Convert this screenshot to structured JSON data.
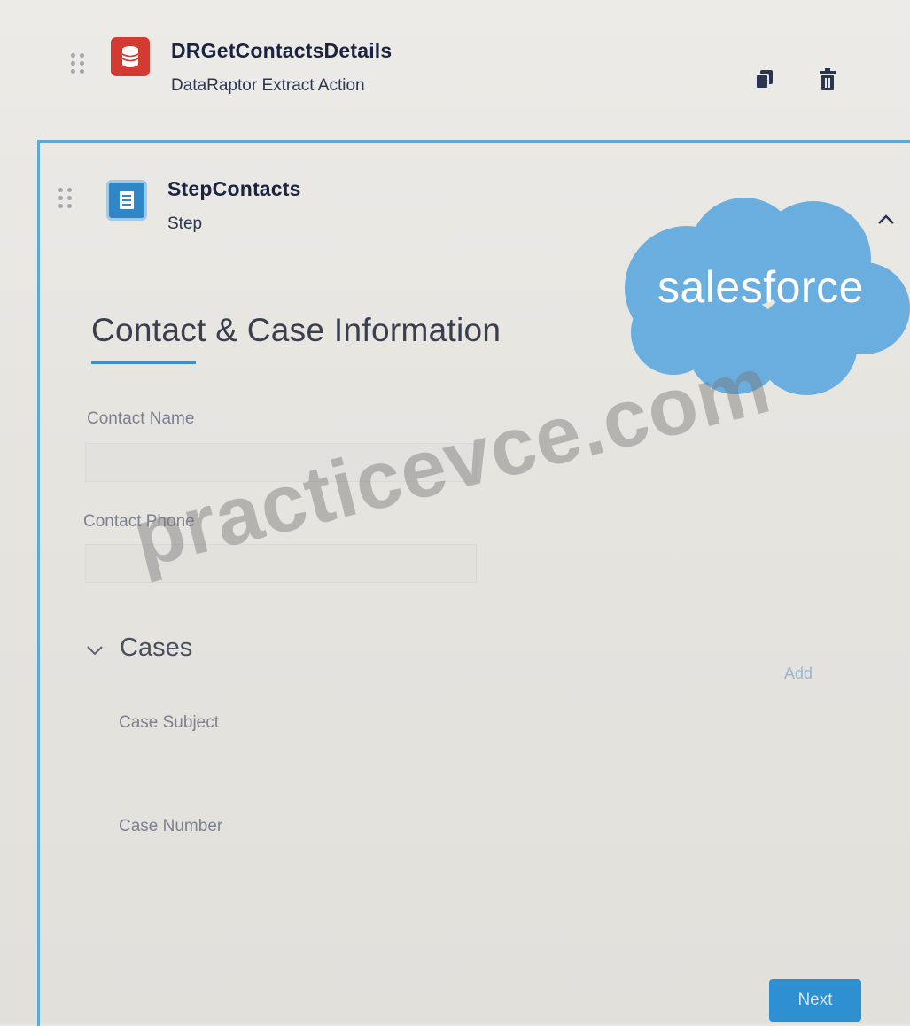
{
  "dataraptor_element": {
    "title": "DRGetContactsDetails",
    "subtitle": "DataRaptor Extract Action",
    "icon": "dataraptor-extract-icon",
    "icon_color": "#d33a32"
  },
  "step_element": {
    "title": "StepContacts",
    "subtitle": "Step",
    "icon": "step-icon",
    "icon_color": "#2f87c8"
  },
  "block": {
    "title": "Contact & Case Information"
  },
  "fields": {
    "contact_name_label": "Contact Name",
    "contact_phone_label": "Contact Phone"
  },
  "cases": {
    "title": "Cases",
    "add_label": "Add",
    "case_subject_label": "Case Subject",
    "case_number_label": "Case Number"
  },
  "buttons": {
    "next_label": "Next"
  },
  "logo": {
    "text": "salesforce",
    "color": "#6aaee0"
  },
  "watermark": {
    "text": "practicevce.com"
  }
}
